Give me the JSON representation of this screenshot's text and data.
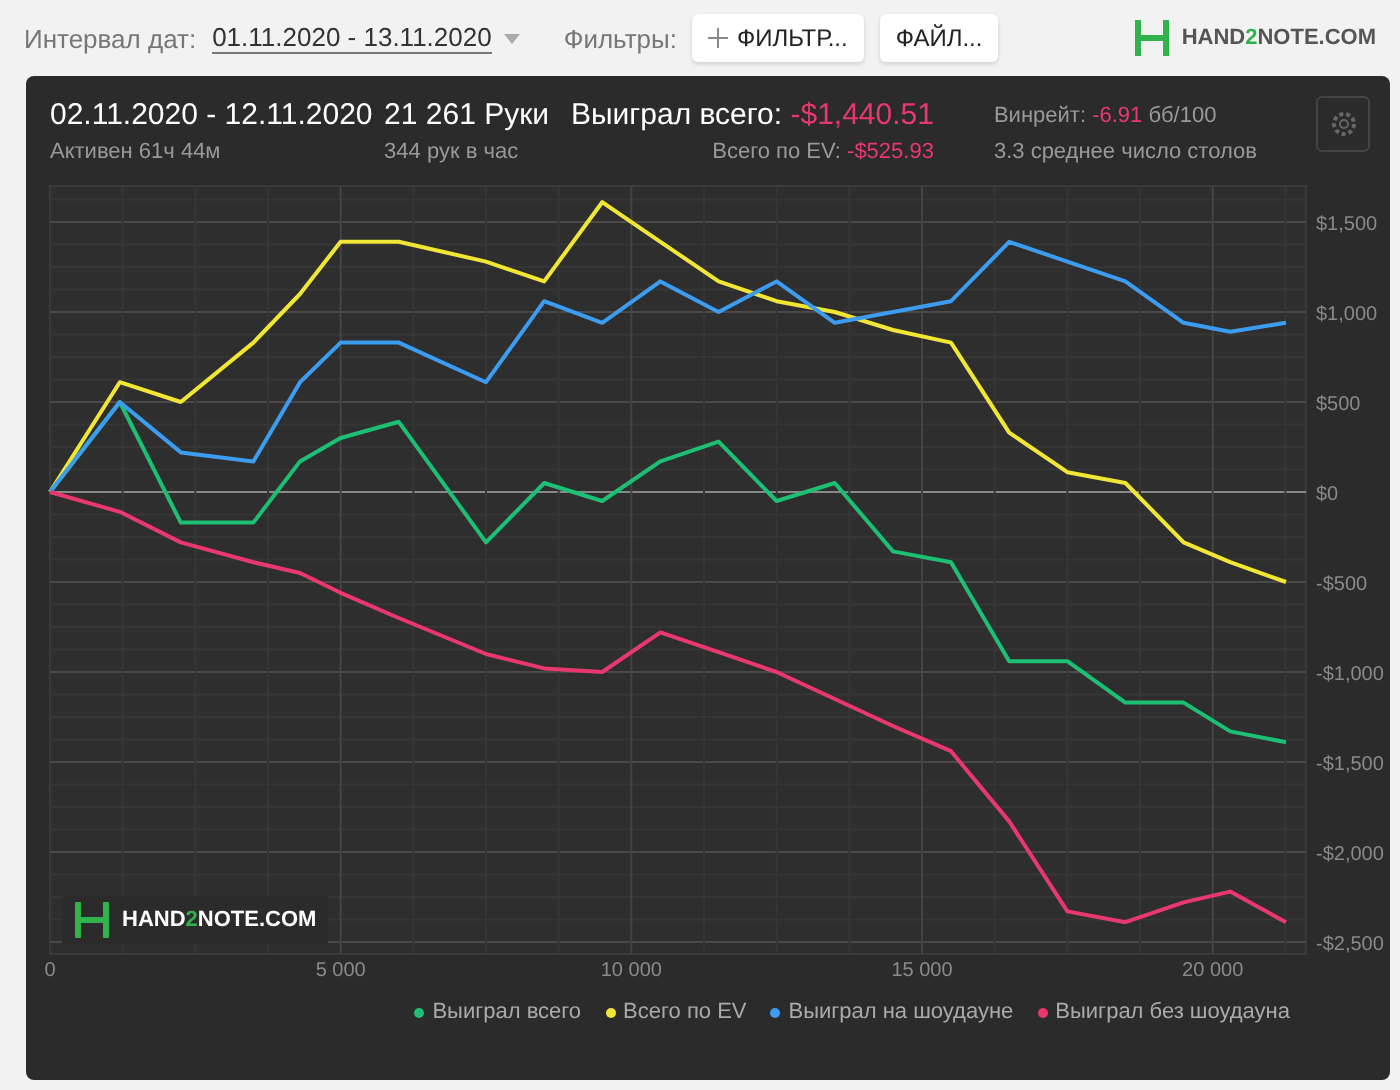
{
  "toolbar": {
    "date_label": "Интервал дат:",
    "date_range": "01.11.2020 - 13.11.2020",
    "filters_label": "Фильтры:",
    "filter_button": "ФИЛЬТР...",
    "file_button": "ФАЙЛ...",
    "logo": [
      "HAND",
      "2",
      "NOTE.COM"
    ]
  },
  "summary": {
    "period": "02.11.2020 - 12.11.2020",
    "active": "Активен 61ч 44м",
    "hands": "21 261 Руки",
    "hands_per_hour": "344 рук в час",
    "won_label": "Выиграл всего:",
    "won_value": "-$1,440.51",
    "ev_label": "Всего по EV:",
    "ev_value": "-$525.93",
    "winrate_label": "Винрейт:",
    "winrate_value": "-6.91",
    "winrate_unit": "бб/100",
    "tables": "3.3 среднее число столов"
  },
  "chart": {
    "watermark": [
      "HAND",
      "2",
      "NOTE.COM"
    ],
    "chart_data": {
      "type": "line",
      "x": [
        0,
        1200,
        2250,
        3500,
        4300,
        5000,
        6000,
        7500,
        8500,
        9500,
        10500,
        11500,
        12500,
        13500,
        14500,
        15500,
        16500,
        17500,
        18500,
        19500,
        20300,
        21261
      ],
      "series": [
        {
          "name": "Выиграл всего",
          "color": "#1dbf73",
          "values": [
            0,
            500,
            -170,
            -170,
            170,
            300,
            390,
            -280,
            50,
            -50,
            170,
            280,
            -50,
            50,
            -330,
            -390,
            -940,
            -940,
            -1170,
            -1170,
            -1330,
            -1390
          ]
        },
        {
          "name": "Всего по EV",
          "color": "#f2e635",
          "values": [
            0,
            610,
            500,
            830,
            1100,
            1390,
            1390,
            1280,
            1170,
            1610,
            1390,
            1170,
            1060,
            1000,
            900,
            830,
            330,
            110,
            50,
            -280,
            -390,
            -500
          ]
        },
        {
          "name": "Выиграл на шоудауне",
          "color": "#3b9cf0",
          "values": [
            0,
            500,
            220,
            170,
            610,
            830,
            830,
            610,
            1060,
            940,
            1170,
            1000,
            1170,
            940,
            1000,
            1060,
            1390,
            1280,
            1170,
            940,
            890,
            940
          ]
        },
        {
          "name": "Выиграл без шоудауна",
          "color": "#e8386f",
          "values": [
            0,
            -110,
            -280,
            -390,
            -450,
            -560,
            -700,
            -900,
            -980,
            -1000,
            -780,
            -890,
            -1000,
            -1150,
            -1300,
            -1440,
            -1830,
            -2330,
            -2390,
            -2280,
            -2220,
            -2390
          ]
        }
      ],
      "xlim": [
        0,
        21261
      ],
      "ylim": [
        -2567,
        1700
      ],
      "grid": true,
      "xticks": [
        {
          "value": 0,
          "label": "0"
        },
        {
          "value": 5000,
          "label": "5 000"
        },
        {
          "value": 10000,
          "label": "10 000"
        },
        {
          "value": 15000,
          "label": "15 000"
        },
        {
          "value": 20000,
          "label": "20 000"
        }
      ],
      "yticks": [
        {
          "value": 1500,
          "label": "$1,500"
        },
        {
          "value": 1000,
          "label": "$1,000"
        },
        {
          "value": 500,
          "label": "$500"
        },
        {
          "value": 0,
          "label": "$0"
        },
        {
          "value": -500,
          "label": "-$500"
        },
        {
          "value": -1000,
          "label": "-$1,000"
        },
        {
          "value": -1500,
          "label": "-$1,500"
        },
        {
          "value": -2000,
          "label": "-$2,000"
        },
        {
          "value": -2500,
          "label": "-$2,500"
        }
      ]
    }
  }
}
